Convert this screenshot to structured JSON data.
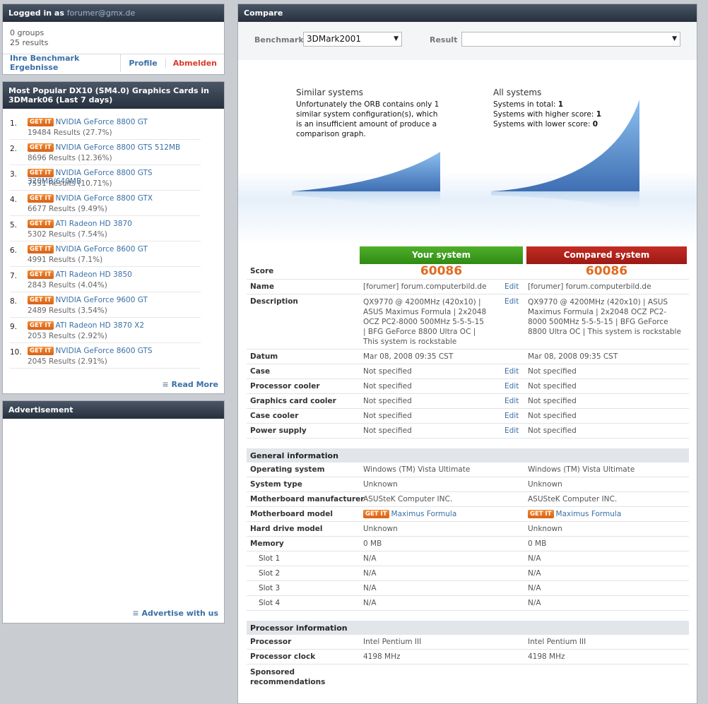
{
  "login": {
    "title_prefix": "Logged in as",
    "user": "forumer@gmx.de",
    "groups": "0 groups",
    "results": "25 results",
    "tab_benchmarks": "Ihre Benchmark Ergebnisse",
    "tab_profile": "Profile",
    "tab_logout": "Abmelden"
  },
  "popular": {
    "title": "Most Popular DX10 (SM4.0) Graphics Cards in 3DMark06 (Last 7 days)",
    "getit": "GET IT",
    "items": [
      {
        "num": "1.",
        "name": "NVIDIA GeForce 8800 GT",
        "results": "19484 Results (27.7%)"
      },
      {
        "num": "2.",
        "name": "NVIDIA GeForce 8800 GTS 512MB",
        "results": "8696 Results (12.36%)"
      },
      {
        "num": "3.",
        "name": "NVIDIA GeForce 8800 GTS 320MB/640MB",
        "results": "7531 Results (10.71%)"
      },
      {
        "num": "4.",
        "name": "NVIDIA GeForce 8800 GTX",
        "results": "6677 Results (9.49%)"
      },
      {
        "num": "5.",
        "name": "ATI Radeon HD 3870",
        "results": "5302 Results (7.54%)"
      },
      {
        "num": "6.",
        "name": "NVIDIA GeForce 8600 GT",
        "results": "4991 Results (7.1%)"
      },
      {
        "num": "7.",
        "name": "ATI Radeon HD 3850",
        "results": "2843 Results (4.04%)"
      },
      {
        "num": "8.",
        "name": "NVIDIA GeForce 9600 GT",
        "results": "2489 Results (3.54%)"
      },
      {
        "num": "9.",
        "name": "ATI Radeon HD 3870 X2",
        "results": "2053 Results (2.92%)"
      },
      {
        "num": "10.",
        "name": "NVIDIA GeForce 8600 GTS",
        "results": "2045 Results (2.91%)"
      }
    ],
    "read_more": "Read More"
  },
  "ads": {
    "title": "Advertisement",
    "link": "Advertise with us"
  },
  "compare": {
    "title": "Compare",
    "benchmark_label": "Benchmark",
    "benchmark_value": "3DMark2001",
    "result_label": "Result",
    "result_value": "",
    "similar_title": "Similar systems",
    "similar_text": "Unfortunately the ORB contains only 1 similar system configuration(s), which is an insufficient amount of produce a comparison graph.",
    "all_title": "All systems",
    "all_total_label": "Systems in total:",
    "all_total": "1",
    "all_higher_label": "Systems with higher score:",
    "all_higher": "1",
    "all_lower_label": "Systems with lower score:",
    "all_lower": "0",
    "your_system": "Your system",
    "compared_system": "Compared system",
    "score_label": "Score",
    "your_score": "60086",
    "compared_score": "60086",
    "edit": "Edit",
    "name_label": "Name",
    "name_a": "[forumer] forum.computerbild.de",
    "name_b": "[forumer] forum.computerbild.de",
    "desc_label": "Description",
    "desc_a": "QX9770 @ 4200MHz (420x10) | ASUS Maximus Formula | 2x2048 OCZ PC2-8000 500MHz 5-5-5-15 | BFG GeForce 8800 Ultra OC | This system is rockstable",
    "desc_b": "QX9770 @ 4200MHz (420x10) | ASUS Maximus Formula | 2x2048 OCZ PC2-8000 500MHz 5-5-5-15 | BFG GeForce 8800 Ultra OC | This system is rockstable",
    "datum_label": "Datum",
    "datum_a": "Mar 08, 2008 09:35 CST",
    "datum_b": "Mar 08, 2008 09:35 CST",
    "not_specified": "Not specified",
    "case_label": "Case",
    "cpu_cooler_label": "Processor cooler",
    "gpu_cooler_label": "Graphics card cooler",
    "case_cooler_label": "Case cooler",
    "psu_label": "Power supply",
    "general_title": "General information",
    "os_label": "Operating system",
    "os_a": "Windows (TM) Vista Ultimate",
    "os_b": "Windows (TM) Vista Ultimate",
    "systype_label": "System type",
    "unknown": "Unknown",
    "mb_manu_label": "Motherboard manufacturer",
    "mb_manu": "ASUSteK Computer INC.",
    "mb_model_label": "Motherboard model",
    "mb_model": "Maximus Formula",
    "hdd_label": "Hard drive model",
    "memory_label": "Memory",
    "memory": "0 MB",
    "slot1": "Slot 1",
    "slot2": "Slot 2",
    "slot3": "Slot 3",
    "slot4": "Slot 4",
    "na": "N/A",
    "processor_title": "Processor information",
    "processor_label": "Processor",
    "processor": "Intel Pentium III",
    "clock_label": "Processor clock",
    "clock": "4198 MHz",
    "sponsored_label": "Sponsored recommendations"
  },
  "colors": {
    "your_green": "#3f9a1c",
    "compared_red": "#b2201a",
    "score_orange": "#e06b1f",
    "link_blue": "#3a6fa8",
    "logout_red": "#d83a2a"
  }
}
